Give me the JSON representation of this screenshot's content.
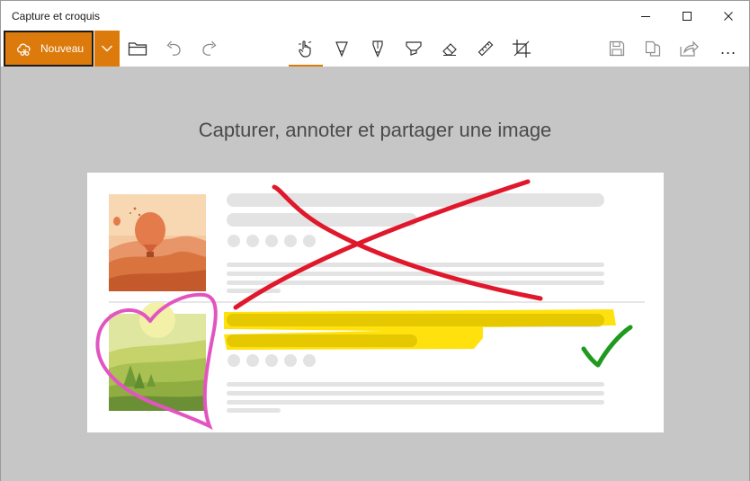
{
  "app": {
    "title": "Capture et croquis"
  },
  "window_controls": {
    "minimize": "minimize-icon",
    "maximize": "maximize-icon",
    "close": "close-icon"
  },
  "toolbar": {
    "new_label": "Nouveau",
    "new_icon": "snip-new-icon",
    "dropdown_icon": "chevron-down-icon",
    "open_icon": "folder-icon",
    "undo_icon": "undo-icon",
    "redo_icon": "redo-icon",
    "touch_writing_icon": "touch-writing-icon",
    "ballpoint_icon": "ballpoint-pen-icon",
    "pencil_icon": "pencil-icon",
    "highlighter_icon": "highlighter-icon",
    "eraser_icon": "eraser-icon",
    "ruler_icon": "ruler-icon",
    "crop_icon": "crop-icon",
    "save_icon": "save-icon",
    "copy_icon": "copy-icon",
    "share_icon": "share-icon",
    "more_label": "..."
  },
  "main": {
    "headline": "Capturer, annoter et partager une image"
  },
  "colors": {
    "accent": "#dc7b0c",
    "canvas_background": "#c6c6c6",
    "red_ink": "#e0182b",
    "pink_ink": "#e255c0",
    "yellow_highlight": "#ffe000",
    "green_ink": "#1f9a1f"
  }
}
